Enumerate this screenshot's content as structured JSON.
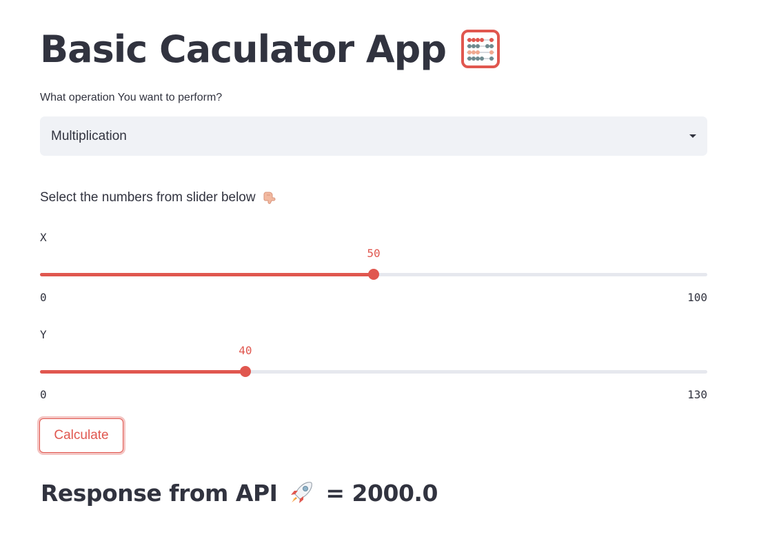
{
  "app": {
    "title": "Basic Caculator App",
    "title_icon": "abacus-icon"
  },
  "operation": {
    "label": "What operation You want to perform?",
    "selected": "Multiplication",
    "caret_icon": "caret-down-icon"
  },
  "hint": {
    "text": "Select the numbers from slider below",
    "icon": "pointing-down-icon"
  },
  "sliders": [
    {
      "label": "X",
      "min": 0,
      "max": 100,
      "value": 50,
      "min_label": "0",
      "max_label": "100",
      "value_label": "50"
    },
    {
      "label": "Y",
      "min": 0,
      "max": 130,
      "value": 40,
      "min_label": "0",
      "max_label": "130",
      "value_label": "40"
    }
  ],
  "actions": {
    "calculate_label": "Calculate"
  },
  "result": {
    "prefix": "Response from API",
    "icon": "rocket-icon",
    "value_text": "= 2000.0"
  },
  "colors": {
    "accent": "#e0574f",
    "text": "#31333f",
    "select_bg": "#f0f2f6",
    "track": "#e6e8ee"
  }
}
